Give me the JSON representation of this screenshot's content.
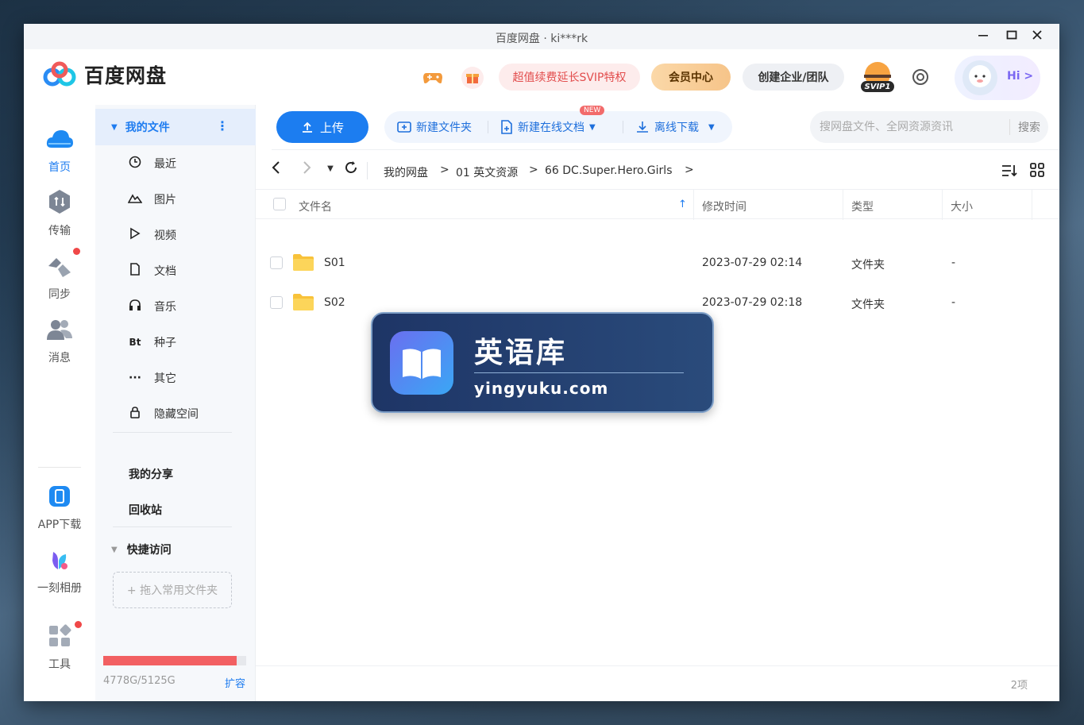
{
  "window": {
    "title": "百度网盘 · ki***rk"
  },
  "header": {
    "logo_text": "百度网盘",
    "promo_label": "超值续费延长SVIP特权",
    "vip_center_label": "会员中心",
    "business_label": "创建企业/团队",
    "svip_badge": "SVIP1",
    "greeting": "Hi >",
    "game_icon": "gamepad-icon",
    "gift_icon": "gift-icon"
  },
  "rail": {
    "items": [
      {
        "label": "首页",
        "icon": "cloud-icon"
      },
      {
        "label": "传输",
        "icon": "transfer-icon"
      },
      {
        "label": "同步",
        "icon": "sync-icon"
      },
      {
        "label": "消息",
        "icon": "people-icon"
      },
      {
        "label": "APP下载",
        "icon": "phone-icon"
      },
      {
        "label": "一刻相册",
        "icon": "album-icon"
      },
      {
        "label": "工具",
        "icon": "apps-icon"
      }
    ]
  },
  "sidenav": {
    "my_files": "我的文件",
    "sub_items": [
      {
        "label": "最近",
        "icon": "clock-icon"
      },
      {
        "label": "图片",
        "icon": "image-icon"
      },
      {
        "label": "视频",
        "icon": "play-icon"
      },
      {
        "label": "文档",
        "icon": "document-icon"
      },
      {
        "label": "音乐",
        "icon": "headphones-icon"
      },
      {
        "label": "种子",
        "icon": "bt-icon",
        "glyph": "Bt"
      },
      {
        "label": "其它",
        "icon": "more-icon",
        "glyph": "···"
      },
      {
        "label": "隐藏空间",
        "icon": "lock-icon"
      }
    ],
    "my_share": "我的分享",
    "recycle_bin": "回收站",
    "quick_access": "快捷访问",
    "drop_hint": "+ 拖入常用文件夹",
    "storage": {
      "used_text": "4778G/5125G",
      "used_fraction": 0.932,
      "expand_label": "扩容"
    }
  },
  "toolbar": {
    "upload_label": "上传",
    "new_folder_label": "新建文件夹",
    "new_doc_label": "新建在线文档",
    "new_badge": "NEW",
    "offline_download_label": "离线下载",
    "search_placeholder": "搜网盘文件、全网资源资讯",
    "search_button": "搜索"
  },
  "breadcrumb": [
    "我的网盘",
    "01 英文资源",
    "66 DC.Super.Hero.Girls"
  ],
  "table": {
    "columns": [
      "文件名",
      "修改时间",
      "类型",
      "大小"
    ],
    "rows": [
      {
        "name": "S01",
        "modified": "2023-07-29 02:14",
        "type": "文件夹",
        "size": "-"
      },
      {
        "name": "S02",
        "modified": "2023-07-29 02:18",
        "type": "文件夹",
        "size": "-"
      }
    ]
  },
  "status": {
    "item_count": "2项"
  },
  "watermark": {
    "title": "英语库",
    "url": "yingyuku.com"
  },
  "colors": {
    "accent": "#1c7df0",
    "storage_bar": "#f26062",
    "promo_text": "#e24d4d"
  }
}
